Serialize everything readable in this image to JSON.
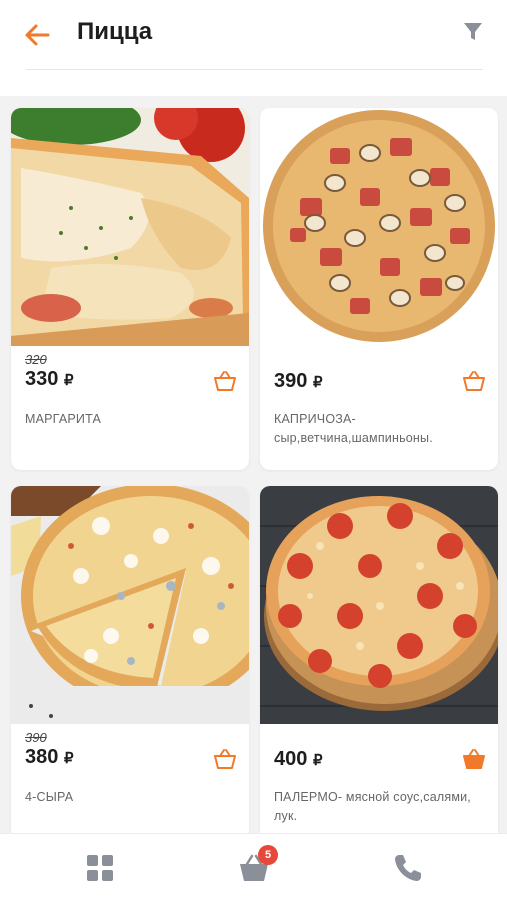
{
  "header": {
    "title": "Пицца",
    "back_icon": "arrow-left-icon",
    "filter_icon": "filter-icon"
  },
  "colors": {
    "accent": "#f07a2a",
    "badge": "#e8483a",
    "icon_gray": "#8a8f99"
  },
  "products": [
    {
      "old_price": "320",
      "price": "330",
      "currency": "₽",
      "name": "МАРГАРИТА",
      "cart_icon": "basket-icon"
    },
    {
      "old_price": "",
      "price": "390",
      "currency": "₽",
      "name": "КАПРИЧОЗА-сыр,ветчина,шампиньоны.",
      "cart_icon": "basket-icon"
    },
    {
      "old_price": "390",
      "price": "380",
      "currency": "₽",
      "name": "4-СЫРА",
      "cart_icon": "basket-icon"
    },
    {
      "old_price": "",
      "price": "400",
      "currency": "₽",
      "name": "ПАЛЕРМО- мясной соус,салями, лук.",
      "cart_icon": "basket-filled-icon"
    }
  ],
  "bottom_nav": {
    "catalog_icon": "grid-icon",
    "cart_icon": "basket-icon",
    "cart_count": "5",
    "phone_icon": "phone-icon"
  }
}
